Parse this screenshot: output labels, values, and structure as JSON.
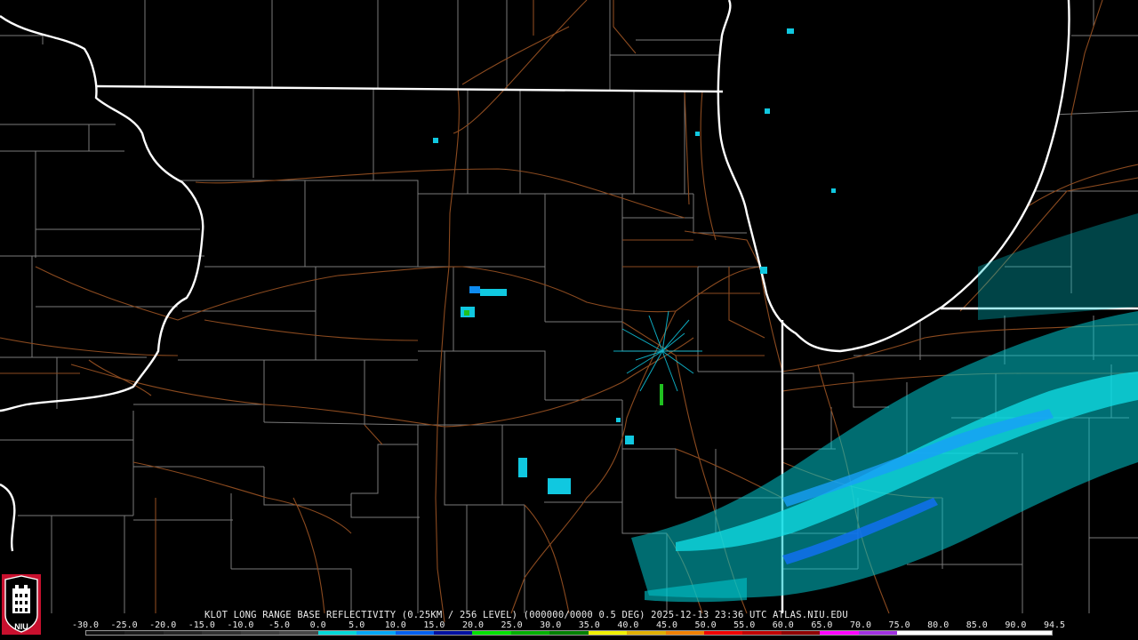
{
  "product": {
    "title": "KLOT LONG RANGE BASE REFLECTIVITY (0.25KM / 256 LEVEL) (000000/0000 0.5 DEG) 2025-12-13 23:36 UTC  ATLAS.NIU.EDU"
  },
  "scale": {
    "labels": [
      "-30.0",
      "-25.0",
      "-20.0",
      "-15.0",
      "-10.0",
      "-5.0",
      "0.0",
      "5.0",
      "10.0",
      "15.0",
      "20.0",
      "25.0",
      "30.0",
      "35.0",
      "40.0",
      "45.0",
      "50.0",
      "55.0",
      "60.0",
      "65.0",
      "70.0",
      "75.0",
      "80.0",
      "85.0",
      "90.0",
      "94.5"
    ],
    "colors": [
      "#111111",
      "#1b1b1b",
      "#262626",
      "#313131",
      "#3c3c3c",
      "#474747",
      "#00d8d8",
      "#00a8f8",
      "#0060f0",
      "#0010a0",
      "#00e000",
      "#00b000",
      "#008000",
      "#f0f000",
      "#e0b000",
      "#f08000",
      "#f00000",
      "#c00000",
      "#900000",
      "#ff00ff",
      "#a030e0",
      "#ffffff",
      "#ffffff",
      "#ffffff",
      "#ffffff"
    ]
  },
  "logo": {
    "text": "NIU",
    "colors": {
      "background": "#c8102e",
      "seal": "#ffffff"
    }
  },
  "map": {
    "colors": {
      "state_borders": "#ffffff",
      "county_lines": "#8a8a8a",
      "highways": "#8b4513",
      "echo_light": "#00d8e0",
      "echo_medium": "#1060f0",
      "echo_strong": "#20c020"
    }
  }
}
